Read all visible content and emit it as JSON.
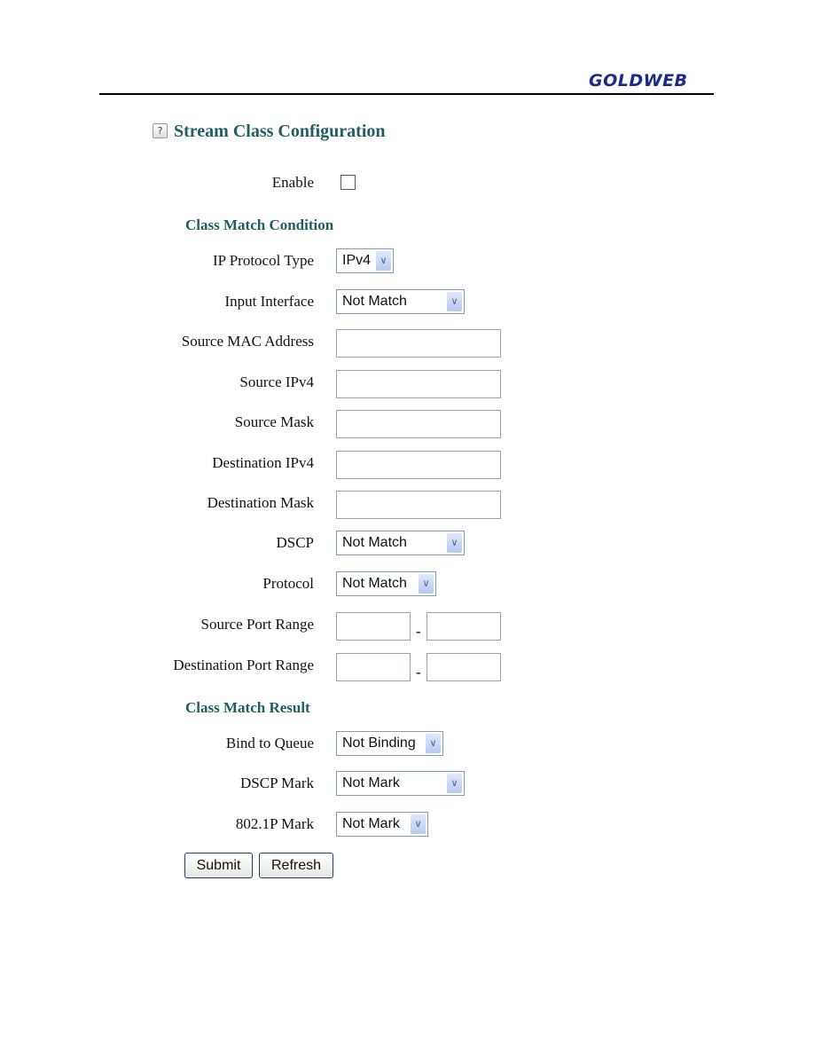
{
  "brand": "GOLDWEB",
  "title": "Stream Class Configuration",
  "help_icon": "?",
  "enable": {
    "label": "Enable",
    "checked": false
  },
  "condition": {
    "heading": "Class Match Condition",
    "ip_protocol_type": {
      "label": "IP Protocol Type",
      "value": "IPv4"
    },
    "input_interface": {
      "label": "Input Interface",
      "value": "Not Match"
    },
    "source_mac": {
      "label": "Source MAC Address",
      "value": ""
    },
    "source_ip": {
      "label": "Source IPv4",
      "value": ""
    },
    "source_mask": {
      "label": "Source Mask",
      "value": ""
    },
    "dest_ip": {
      "label": "Destination IPv4",
      "value": ""
    },
    "dest_mask": {
      "label": "Destination Mask",
      "value": ""
    },
    "dscp": {
      "label": "DSCP",
      "value": "Not Match"
    },
    "protocol": {
      "label": "Protocol",
      "value": "Not Match"
    },
    "source_port_range": {
      "label": "Source Port Range",
      "separator": "-",
      "from": "",
      "to": ""
    },
    "dest_port_range": {
      "label": "Destination Port Range",
      "separator": "-",
      "from": "",
      "to": ""
    }
  },
  "result": {
    "heading": "Class Match Result",
    "bind_to_queue": {
      "label": "Bind to Queue",
      "value": "Not Binding"
    },
    "dscp_mark": {
      "label": "DSCP Mark",
      "value": "Not Mark"
    },
    "p8021_mark": {
      "label": "802.1P Mark",
      "value": "Not Mark"
    }
  },
  "buttons": {
    "submit": "Submit",
    "refresh": "Refresh"
  }
}
